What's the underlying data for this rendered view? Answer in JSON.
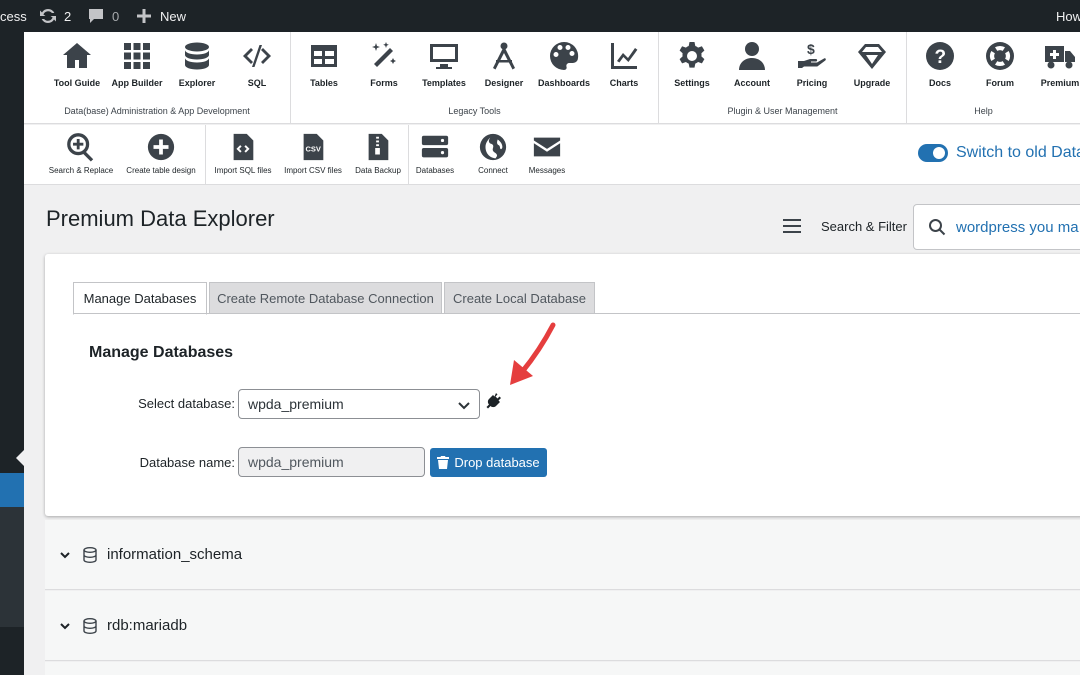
{
  "adminbar": {
    "site_fragment": "cess",
    "updates_count": "2",
    "comments_count": "0",
    "new_label": "New",
    "howdy_fragment": "How"
  },
  "toolbar1": {
    "groups": [
      {
        "label": "Data(base) Administration & App Development",
        "items": [
          {
            "label": "Tool Guide",
            "icon": "home-icon"
          },
          {
            "label": "App Builder",
            "icon": "grid-icon"
          },
          {
            "label": "Explorer",
            "icon": "database-icon"
          },
          {
            "label": "SQL",
            "icon": "code-icon"
          }
        ]
      },
      {
        "label": "Legacy Tools",
        "items": [
          {
            "label": "Tables",
            "icon": "table-icon"
          },
          {
            "label": "Forms",
            "icon": "magic-wand-icon"
          },
          {
            "label": "Templates",
            "icon": "monitor-icon"
          },
          {
            "label": "Designer",
            "icon": "compass-icon"
          },
          {
            "label": "Dashboards",
            "icon": "palette-icon"
          },
          {
            "label": "Charts",
            "icon": "line-chart-icon"
          }
        ]
      },
      {
        "label": "Plugin & User Management",
        "items": [
          {
            "label": "Settings",
            "icon": "gear-icon"
          },
          {
            "label": "Account",
            "icon": "user-icon"
          },
          {
            "label": "Pricing",
            "icon": "pricing-hand-icon"
          },
          {
            "label": "Upgrade",
            "icon": "diamond-icon"
          }
        ]
      },
      {
        "label": "Help",
        "items": [
          {
            "label": "Docs",
            "icon": "question-icon"
          },
          {
            "label": "Forum",
            "icon": "lifebuoy-icon"
          },
          {
            "label": "Premium",
            "icon": "truck-icon"
          }
        ]
      }
    ]
  },
  "toolbar2": {
    "items": [
      {
        "label": "Search & Replace",
        "icon": "search-plus-icon"
      },
      {
        "label": "Create table design",
        "icon": "plus-circle-icon"
      },
      {
        "label": "Import SQL files",
        "icon": "file-code-icon"
      },
      {
        "label": "Import CSV files",
        "icon": "file-csv-icon"
      },
      {
        "label": "Data Backup",
        "icon": "file-zip-icon"
      },
      {
        "label": "Databases",
        "icon": "server-icon"
      },
      {
        "label": "Connect",
        "icon": "globe-icon"
      },
      {
        "label": "Messages",
        "icon": "envelope-icon"
      }
    ],
    "switch_label": "Switch to old Data"
  },
  "page": {
    "title": "Premium Data Explorer",
    "filter_label": "Search & Filter",
    "search_value": "wordpress you ma"
  },
  "panel": {
    "tabs": [
      "Manage Databases",
      "Create Remote Database Connection",
      "Create Local Database"
    ],
    "section_title": "Manage Databases",
    "select_label": "Select database:",
    "select_value": "wpda_premium",
    "name_label": "Database name:",
    "name_value": "wpda_premium",
    "drop_label": "Drop database"
  },
  "databases": [
    "information_schema",
    "rdb:mariadb"
  ],
  "colors": {
    "accent": "#2271b1",
    "adminbar": "#1d2327",
    "annotation_arrow": "#e53e3e"
  }
}
